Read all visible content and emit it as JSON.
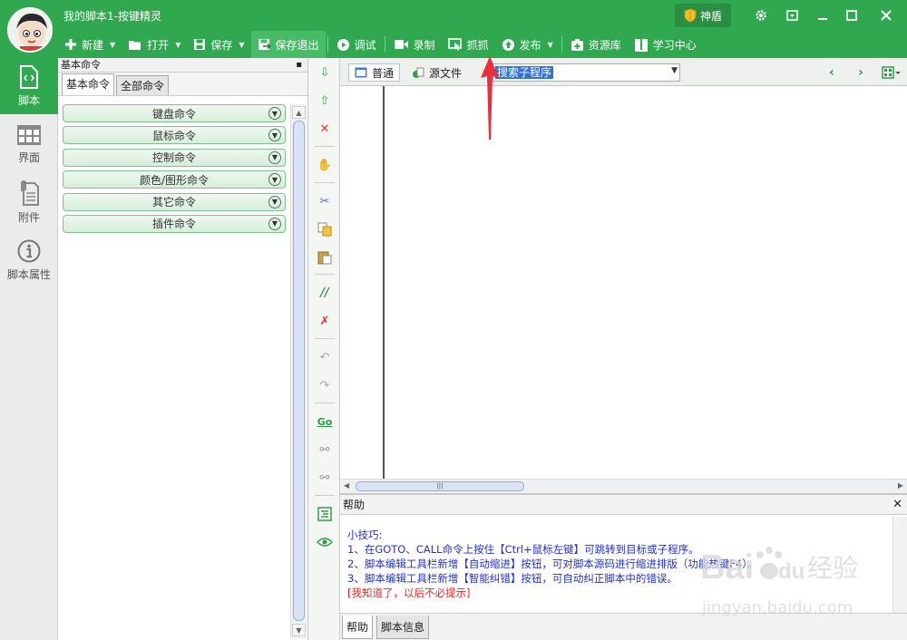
{
  "app": {
    "title": "我的脚本1-按键精灵"
  },
  "title_bar": {
    "shield_label": "神盾",
    "shield_color": "#f2c028"
  },
  "toolbar": {
    "items": [
      {
        "label": "新建",
        "icon": "plus-icon",
        "dropdown": true
      },
      {
        "label": "打开",
        "icon": "folder-icon",
        "dropdown": true
      },
      {
        "label": "保存",
        "icon": "floppy-icon",
        "dropdown": true
      },
      {
        "label": "保存退出",
        "icon": "floppy-exit-icon",
        "dropdown": false,
        "active": true
      },
      {
        "label": "调试",
        "icon": "play-circle-icon",
        "dropdown": false
      },
      {
        "label": "录制",
        "icon": "video-camera-icon",
        "dropdown": false
      },
      {
        "label": "抓抓",
        "icon": "screen-capture-icon",
        "dropdown": false
      },
      {
        "label": "发布",
        "icon": "upload-circle-icon",
        "dropdown": true
      },
      {
        "label": "资源库",
        "icon": "plus-box-icon",
        "dropdown": false
      },
      {
        "label": "学习中心",
        "icon": "book-icon",
        "dropdown": false
      }
    ]
  },
  "left_nav": {
    "items": [
      {
        "label": "脚本",
        "icon": "code-file-icon",
        "active": true
      },
      {
        "label": "界面",
        "icon": "grid-icon",
        "active": false
      },
      {
        "label": "附件",
        "icon": "attachment-icon",
        "active": false
      },
      {
        "label": "脚本属性",
        "icon": "info-icon",
        "active": false
      }
    ]
  },
  "command_panel": {
    "header": "基本命令",
    "tabs": [
      "基本命令",
      "全部命令"
    ],
    "commands": [
      "键盘命令",
      "鼠标命令",
      "控制命令",
      "颜色/图形命令",
      "其它命令",
      "插件命令"
    ]
  },
  "editor": {
    "modes": [
      "普通",
      "源文件"
    ],
    "search_placeholder": "搜索子程序"
  },
  "help": {
    "title": "帮助",
    "tip_heading": "小技巧:",
    "lines": [
      "1、在GOTO、CALL命令上按住【Ctrl+鼠标左键】可跳转到目标或子程序。",
      "2、脚本编辑工具栏新增【自动缩进】按钮，可对脚本源码进行缩进排版（功能热键F4）。",
      "3、脚本编辑工具栏新增【智能纠错】按钮，可自动纠正脚本中的错误。"
    ],
    "dismiss": "[我知道了，以后不必提示]",
    "tabs": [
      "帮助",
      "脚本信息"
    ]
  },
  "watermark": {
    "brand": "Bai",
    "brand2": "du",
    "site_cn": "经验",
    "url": "jingyan.baidu.com"
  },
  "colors": {
    "primary_green": "#2fa84f",
    "annotation_red": "#e8303a"
  }
}
